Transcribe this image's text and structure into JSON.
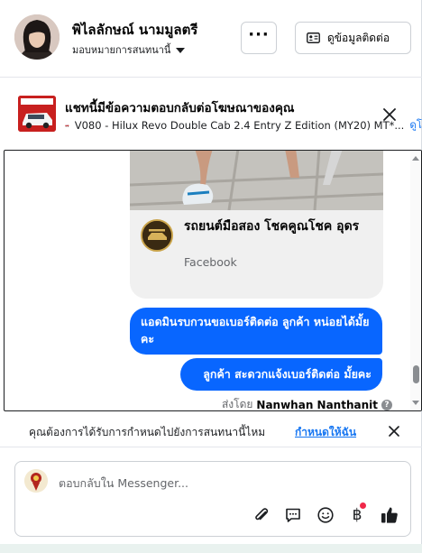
{
  "header": {
    "name": "พิไลลักษณ์ นามมูลตรี",
    "assign_label": "มอบหมายการสนทนานี้",
    "more_label": "···",
    "contact_button_label": "ดูข้อมูลติดต่อ"
  },
  "ad_banner": {
    "title": "แชทนี้มีข้อความตอบกลับต่อโฆษณาของคุณ",
    "ad_text": "V080 - Hilux Revo Double Cab 2.4 Entry Z Edition (MY20) MT*...",
    "link_text": "ดูโ"
  },
  "thread": {
    "shared_post": {
      "page_name": "รถยนต์มือสอง โชคคูณโชค อุดร",
      "source": "Facebook"
    },
    "messages": [
      {
        "text": "แอดมินรบกวนขอเบอร์ติดต่อ ลูกค้า   หน่อยได้มั้ยคะ"
      },
      {
        "text": "ลูกค้า  สะดวกแจ้งเบอร์ติดต่อ มั้ยคะ"
      }
    ],
    "sent_by_prefix": "ส่งโดย",
    "sent_by_name": "Nanwhan Nanthanit",
    "help_glyph": "?"
  },
  "assign_prompt": {
    "text": "คุณต้องการได้รับการกำหนดไปยังการสนทนานี้ไหม",
    "link": "กำหนดให้ฉัน"
  },
  "composer": {
    "placeholder": "ตอบกลับใน Messenger...",
    "baht_glyph": "฿"
  },
  "colors": {
    "accent": "#0866ff",
    "link": "#1877f2",
    "badge": "#f02849"
  },
  "icons": [
    "more-icon",
    "contact-card-icon",
    "close-icon",
    "car-icon",
    "attach-icon",
    "saved-reply-icon",
    "emoji-icon",
    "baht-icon",
    "like-icon",
    "help-icon"
  ]
}
